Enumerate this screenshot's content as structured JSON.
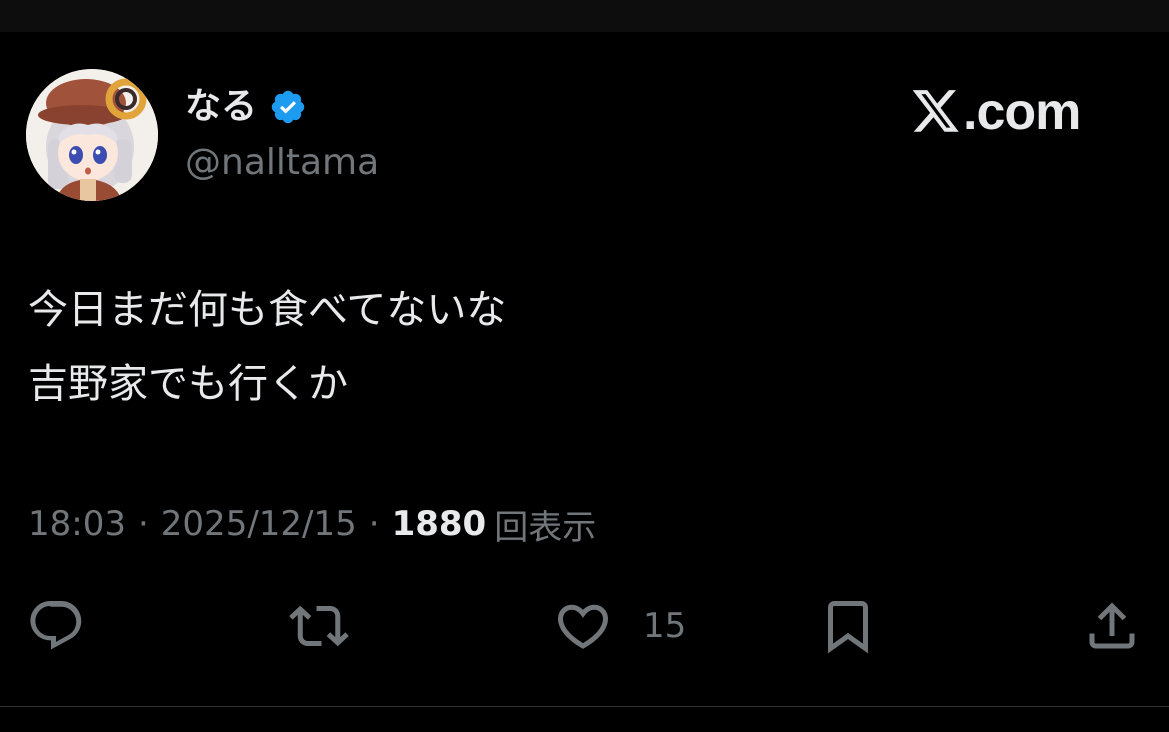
{
  "author": {
    "display_name": "なる",
    "handle": "@nalltama",
    "verified": true
  },
  "brand": {
    "site_label": ".com",
    "site_mark": "X"
  },
  "tweet": {
    "lines": [
      "今日まだ何も食べてないな",
      "吉野家でも行くか"
    ]
  },
  "meta": {
    "time": "18:03",
    "separator": "·",
    "date": "2025/12/15",
    "views_count": "1880",
    "views_label": "回表示"
  },
  "actions": {
    "reply_count": "",
    "repost_count": "",
    "like_count": "15",
    "bookmark_count": ""
  },
  "icons": {
    "reply": "reply-icon",
    "repost": "repost-icon",
    "like": "heart-icon",
    "bookmark": "bookmark-icon",
    "share": "share-icon",
    "verified": "verified-badge-icon"
  },
  "colors": {
    "background": "#000000",
    "text": "#e7e9ea",
    "muted": "#71767b",
    "verified_blue": "#1d9bf0"
  }
}
